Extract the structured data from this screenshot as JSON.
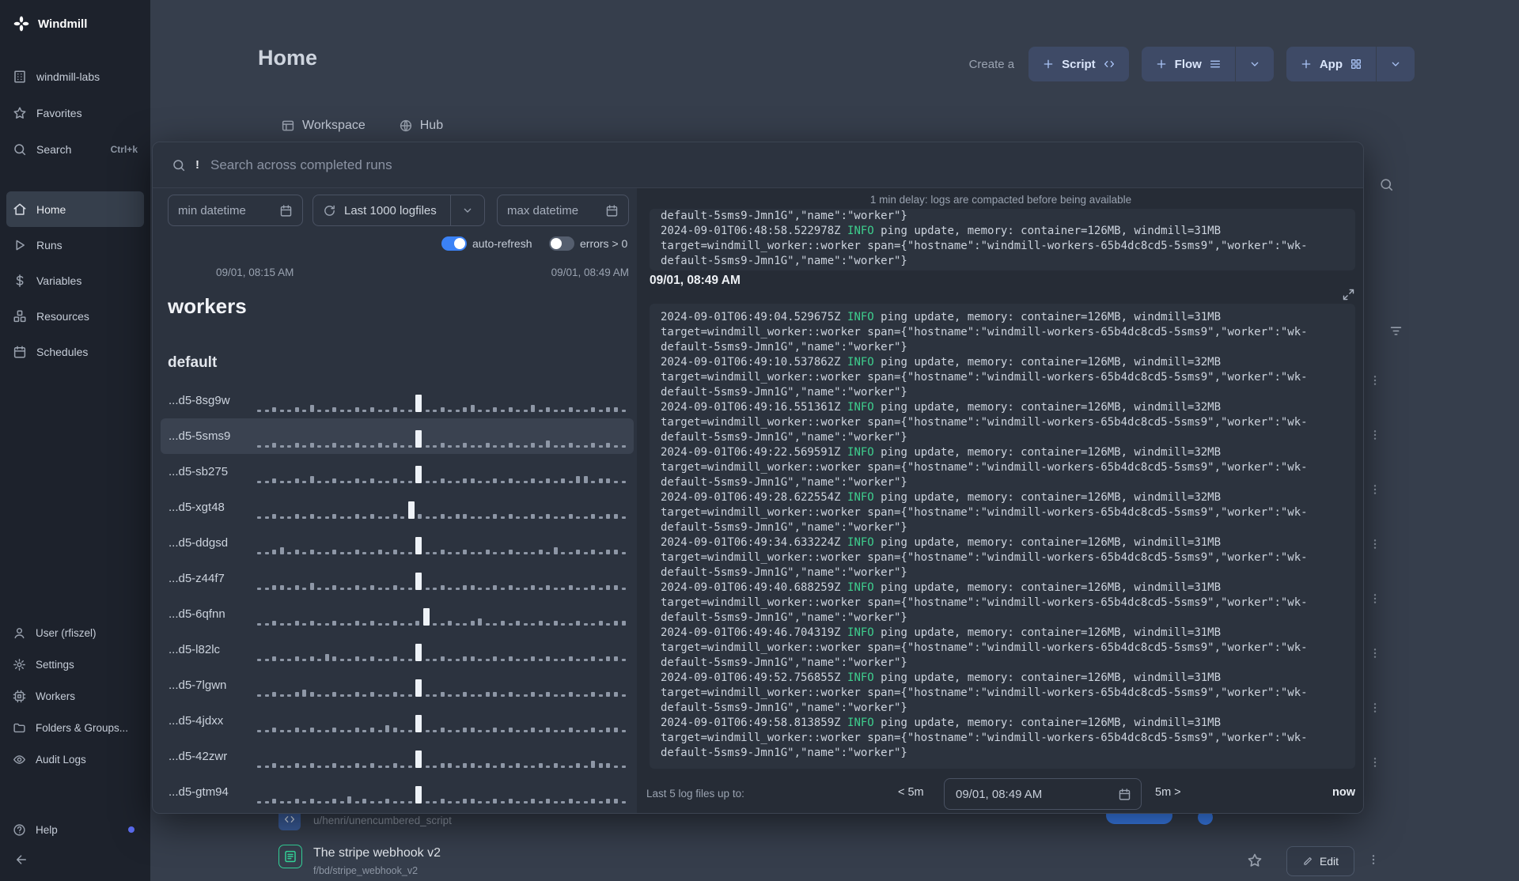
{
  "app": {
    "name": "Windmill"
  },
  "sidebar": {
    "logo_label": "Windmill",
    "items": [
      {
        "label": "windmill-labs",
        "icon": "building-icon"
      },
      {
        "label": "Favorites",
        "icon": "star-icon"
      },
      {
        "label": "Search",
        "icon": "search-icon",
        "shortcut": "Ctrl+k"
      },
      {
        "label": "Home",
        "icon": "home-icon",
        "active": true
      },
      {
        "label": "Runs",
        "icon": "play-icon"
      },
      {
        "label": "Variables",
        "icon": "dollar-icon"
      },
      {
        "label": "Resources",
        "icon": "boxes-icon"
      },
      {
        "label": "Schedules",
        "icon": "calendar-icon"
      }
    ],
    "bottom_items": [
      {
        "label": "User (rfiszel)",
        "icon": "user-icon"
      },
      {
        "label": "Settings",
        "icon": "gear-icon"
      },
      {
        "label": "Workers",
        "icon": "cpu-icon"
      },
      {
        "label": "Folders & Groups...",
        "icon": "folder-icon"
      },
      {
        "label": "Audit Logs",
        "icon": "eye-icon"
      }
    ],
    "help_label": "Help"
  },
  "header": {
    "title": "Home",
    "create_label": "Create a",
    "create_buttons": [
      {
        "label": "Script",
        "leading_icon": "plus-icon",
        "trailing_icon": "code-icon",
        "dropdown": false
      },
      {
        "label": "Flow",
        "leading_icon": "plus-icon",
        "trailing_icon": "list-icon",
        "dropdown": true
      },
      {
        "label": "App",
        "leading_icon": "plus-icon",
        "trailing_icon": "grid-icon",
        "dropdown": true
      }
    ],
    "tabs": [
      {
        "label": "Workspace",
        "icon": "window-icon"
      },
      {
        "label": "Hub",
        "icon": "globe-icon"
      }
    ]
  },
  "drawer": {
    "search": {
      "prefix": "!",
      "placeholder": "Search across completed runs"
    },
    "filters": {
      "min_datetime_placeholder": "min datetime",
      "logfiles_label": "Last 1000 logfiles",
      "max_datetime_placeholder": "max datetime",
      "auto_refresh_label": "auto-refresh",
      "auto_refresh_on": true,
      "errors_label": "errors > 0",
      "errors_on": false,
      "range_start": "09/01, 08:15 AM",
      "range_end": "09/01, 08:49 AM"
    },
    "workers": {
      "title": "workers",
      "group": "default",
      "selected": "...d5-5sms9",
      "list": [
        {
          "name": "...d5-8sg9w",
          "bars": "112112131121121211211X112112311212113121121121221"
        },
        {
          "name": "...d5-5sms9",
          "bars": "112112121121121121211X112112112112112131121121211"
        },
        {
          "name": "...d5-sb275",
          "bars": "112112131121121211211X112112211212112121213312211"
        },
        {
          "name": "...d5-xgt48",
          "bars": "11211212112112121121X2112122111212112121121121221"
        },
        {
          "name": "...d5-ddgsd",
          "bars": "112312121121121121211X112112112112111213112121221"
        },
        {
          "name": "...d5-z44f7",
          "bars": "112212131121121211211X112112211212112121121121221"
        },
        {
          "name": "...d5-6qfnn",
          "bars": "1121121211211212112112X11211231121211212112112122"
        },
        {
          "name": "...d5-l82lc",
          "bars": "112112121321121211211X112112211212112121121121221"
        },
        {
          "name": "...d5-7lgwn",
          "bars": "112112321121121211211X112112112212112121121121221"
        },
        {
          "name": "...d5-4jdxx",
          "bars": "112112121121121213211X112112211212112121121121221"
        },
        {
          "name": "...d5-42zwr",
          "bars": "112112121121121211211X112212212121211212112132211"
        },
        {
          "name": "...d5-gtm94",
          "bars": "112112121121312112111X112112211212112121121121221"
        }
      ]
    },
    "logs": {
      "delay_notice": "1 min delay: logs are compacted before being available",
      "target_line": "target=windmill_worker::worker span={\"hostname\":\"windmill-workers-65b4dc8cd5-5sms9\",\"worker\":\"wk-default-5sms9-Jmn1G\",\"name\":\"worker\"}",
      "previous_block": {
        "tail_line": "default-5sms9-Jmn1G\",\"name\":\"worker\"}",
        "entries": [
          {
            "ts": "2024-09-01T06:48:58.522978Z",
            "level": "INFO",
            "msg": "ping update, memory: container=126MB, windmill=31MB"
          }
        ]
      },
      "date_header": "09/01, 08:49 AM",
      "entries": [
        {
          "ts": "2024-09-01T06:49:04.529675Z",
          "level": "INFO",
          "msg": "ping update, memory: container=126MB, windmill=31MB"
        },
        {
          "ts": "2024-09-01T06:49:10.537862Z",
          "level": "INFO",
          "msg": "ping update, memory: container=126MB, windmill=32MB"
        },
        {
          "ts": "2024-09-01T06:49:16.551361Z",
          "level": "INFO",
          "msg": "ping update, memory: container=126MB, windmill=32MB"
        },
        {
          "ts": "2024-09-01T06:49:22.569591Z",
          "level": "INFO",
          "msg": "ping update, memory: container=126MB, windmill=32MB"
        },
        {
          "ts": "2024-09-01T06:49:28.622554Z",
          "level": "INFO",
          "msg": "ping update, memory: container=126MB, windmill=32MB"
        },
        {
          "ts": "2024-09-01T06:49:34.633224Z",
          "level": "INFO",
          "msg": "ping update, memory: container=126MB, windmill=31MB"
        },
        {
          "ts": "2024-09-01T06:49:40.688259Z",
          "level": "INFO",
          "msg": "ping update, memory: container=126MB, windmill=31MB"
        },
        {
          "ts": "2024-09-01T06:49:46.704319Z",
          "level": "INFO",
          "msg": "ping update, memory: container=126MB, windmill=31MB"
        },
        {
          "ts": "2024-09-01T06:49:52.756855Z",
          "level": "INFO",
          "msg": "ping update, memory: container=126MB, windmill=31MB"
        },
        {
          "ts": "2024-09-01T06:49:58.813859Z",
          "level": "INFO",
          "msg": "ping update, memory: container=126MB, windmill=31MB"
        }
      ],
      "footer": {
        "label": "Last 5 log files up to:",
        "back": "< 5m",
        "datetime_value": "09/01, 08:49 AM",
        "forward": "5m >",
        "now": "now"
      }
    }
  },
  "background": {
    "row1_path": "u/henri/unencumbered_script",
    "row2_title": "The stripe webhook v2",
    "row2_path": "f/bd/stripe_webhook_v2",
    "edit_label": "Edit"
  },
  "right_rail": {
    "row_menu_count": 8
  }
}
